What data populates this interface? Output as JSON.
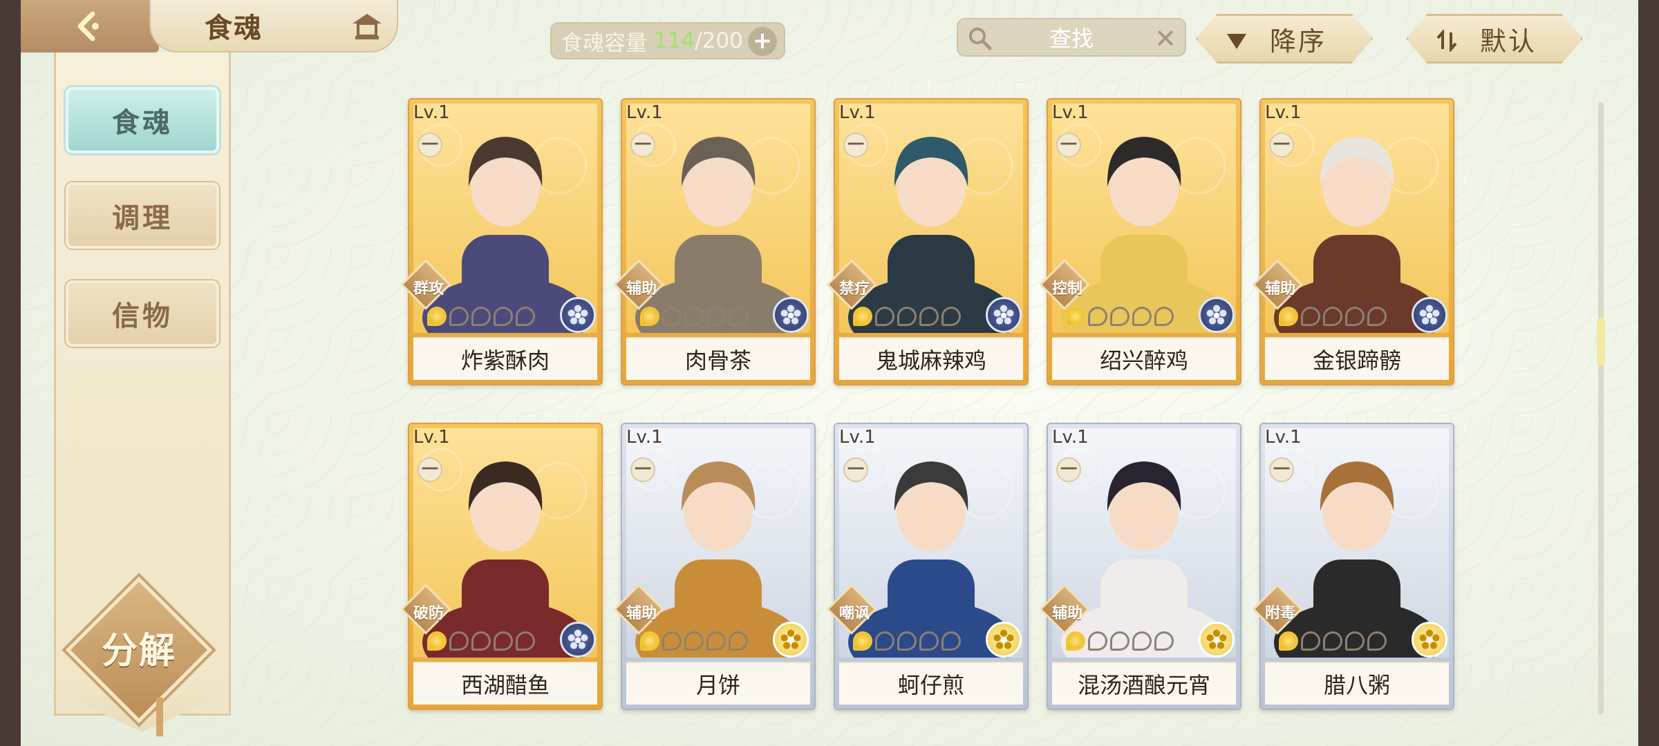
{
  "header": {
    "title": "食魂",
    "capacity": {
      "label": "食魂容量",
      "current": "114",
      "separator": "/",
      "max": "200"
    },
    "search": {
      "placeholder": "查找"
    },
    "sort_order_label": "降序",
    "sort_mode_label": "默认"
  },
  "sidebar": {
    "items": [
      {
        "label": "食魂",
        "active": true
      },
      {
        "label": "调理",
        "active": false
      },
      {
        "label": "信物",
        "active": false
      }
    ],
    "decompose_label": "分解"
  },
  "colors": {
    "gold_frame": "#f4c65b",
    "silver_frame": "#c7d0de",
    "capacity_current": "#9ee36f",
    "tab_active": "#a8dcd4"
  },
  "cards": [
    {
      "level": "Lv.1",
      "badge": "一",
      "role": "群攻",
      "name": "炸紫酥肉",
      "rarity": "gold",
      "stars_filled": 1,
      "stars_total": 5,
      "emblem": "blue-flower-icon"
    },
    {
      "level": "Lv.1",
      "badge": "一",
      "role": "辅助",
      "name": "肉骨茶",
      "rarity": "gold",
      "stars_filled": 1,
      "stars_total": 5,
      "emblem": "blue-flower-icon"
    },
    {
      "level": "Lv.1",
      "badge": "一",
      "role": "禁疗",
      "name": "鬼城麻辣鸡",
      "rarity": "gold",
      "stars_filled": 1,
      "stars_total": 5,
      "emblem": "blue-flower-icon"
    },
    {
      "level": "Lv.1",
      "badge": "一",
      "role": "控制",
      "name": "绍兴醉鸡",
      "rarity": "gold",
      "stars_filled": 1,
      "stars_total": 5,
      "emblem": "blue-flower-icon"
    },
    {
      "level": "Lv.1",
      "badge": "一",
      "role": "辅助",
      "name": "金银蹄髈",
      "rarity": "gold",
      "stars_filled": 1,
      "stars_total": 5,
      "emblem": "blue-flower-icon"
    },
    {
      "level": "Lv.1",
      "badge": "一",
      "role": "破防",
      "name": "西湖醋鱼",
      "rarity": "gold",
      "stars_filled": 1,
      "stars_total": 5,
      "emblem": "blue-flower-icon"
    },
    {
      "level": "Lv.1",
      "badge": "一",
      "role": "辅助",
      "name": "月饼",
      "rarity": "silver",
      "stars_filled": 1,
      "stars_total": 5,
      "emblem": "gold-flower-icon"
    },
    {
      "level": "Lv.1",
      "badge": "一",
      "role": "嘲讽",
      "name": "蚵仔煎",
      "rarity": "silver",
      "stars_filled": 1,
      "stars_total": 5,
      "emblem": "gold-flower-icon"
    },
    {
      "level": "Lv.1",
      "badge": "一",
      "role": "辅助",
      "name": "混汤酒酿元宵",
      "rarity": "silver",
      "stars_filled": 1,
      "stars_total": 5,
      "emblem": "gold-flower-icon"
    },
    {
      "level": "Lv.1",
      "badge": "一",
      "role": "附毒",
      "name": "腊八粥",
      "rarity": "silver",
      "stars_filled": 1,
      "stars_total": 5,
      "emblem": "gold-flower-icon"
    }
  ]
}
